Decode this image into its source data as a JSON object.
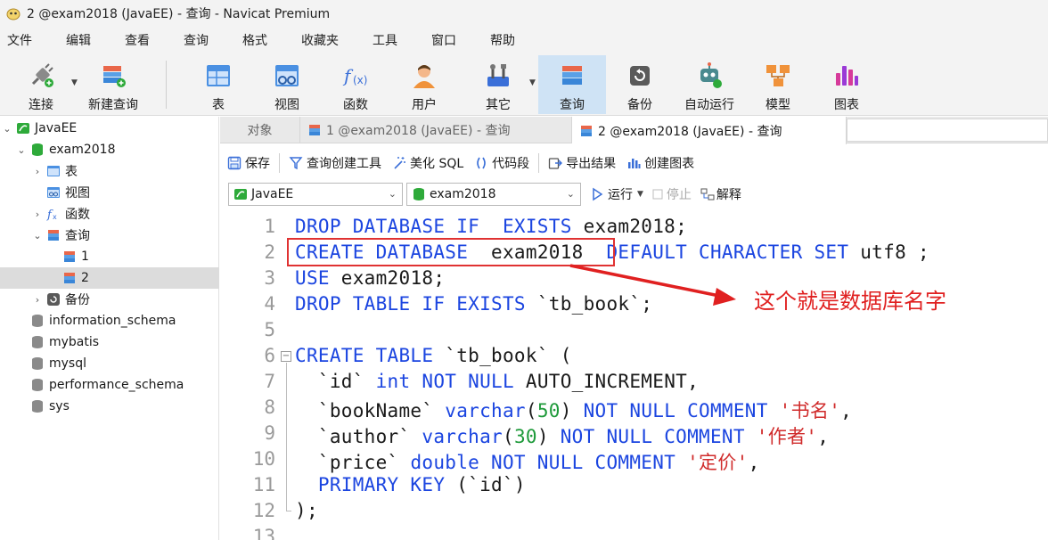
{
  "window": {
    "title": "2 @exam2018 (JavaEE) - 查询 - Navicat Premium"
  },
  "menu": [
    "文件",
    "编辑",
    "查看",
    "查询",
    "格式",
    "收藏夹",
    "工具",
    "窗口",
    "帮助"
  ],
  "toolbar": {
    "connect": "连接",
    "new_query": "新建查询",
    "table": "表",
    "view": "视图",
    "function": "函数",
    "user": "用户",
    "other": "其它",
    "query": "查询",
    "backup": "备份",
    "automation": "自动运行",
    "model": "模型",
    "chart": "图表"
  },
  "sidebar": {
    "connection": "JavaEE",
    "database": "exam2018",
    "tables": "表",
    "views": "视图",
    "functions": "函数",
    "queries": "查询",
    "query_1": "1",
    "query_2": "2",
    "backups": "备份",
    "other_dbs": [
      "information_schema",
      "mybatis",
      "mysql",
      "performance_schema",
      "sys"
    ]
  },
  "tabs": {
    "objects": "对象",
    "tab1": "1 @exam2018 (JavaEE) - 查询",
    "tab2": "2 @exam2018 (JavaEE) - 查询"
  },
  "query_toolbar": {
    "save": "保存",
    "builder": "查询创建工具",
    "beautify": "美化 SQL",
    "snippet": "代码段",
    "export": "导出结果",
    "create_chart": "创建图表"
  },
  "select_bar": {
    "connection": "JavaEE",
    "database": "exam2018",
    "run": "运行",
    "stop": "停止",
    "explain": "解释"
  },
  "editor": {
    "line_numbers": [
      "1",
      "2",
      "3",
      "4",
      "5",
      "6",
      "7",
      "8",
      "9",
      "10",
      "11",
      "12",
      "13"
    ]
  },
  "annotation": "这个就是数据库名字",
  "colors": {
    "keyword": "#1b45e0",
    "string": "#d02b2b",
    "number": "#1e9a3a",
    "annotation": "#e02020"
  }
}
